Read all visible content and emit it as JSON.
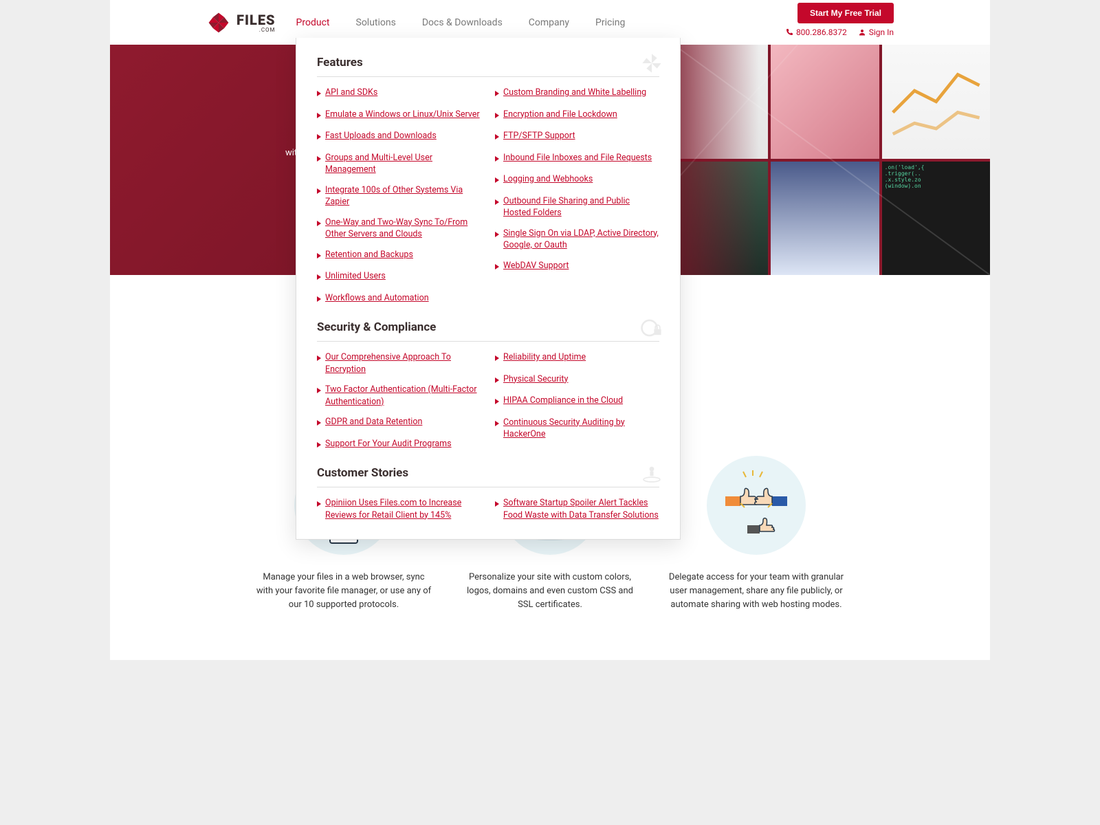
{
  "header": {
    "brand": {
      "word": "FILES",
      "tld": ".COM"
    },
    "nav": [
      {
        "label": "Product",
        "active": true
      },
      {
        "label": "Solutions",
        "active": false
      },
      {
        "label": "Docs & Downloads",
        "active": false
      },
      {
        "label": "Company",
        "active": false
      },
      {
        "label": "Pricing",
        "active": false
      }
    ],
    "trial": "Start My Free Trial",
    "phone": "800.286.8372",
    "signin": "Sign In"
  },
  "hero": {
    "sub_fragment": "with"
  },
  "mega": {
    "sections": [
      {
        "title": "Features",
        "left": [
          "API and SDKs",
          "Emulate a Windows or Linux/Unix Server",
          "Fast Uploads and Downloads",
          "Groups and Multi-Level User Management",
          "Integrate 100s of Other Systems Via Zapier",
          "One-Way and Two-Way Sync To/From Other Servers and Clouds",
          "Retention and Backups",
          "Unlimited Users",
          "Workflows and Automation"
        ],
        "right": [
          "Custom Branding and White Labelling",
          "Encryption and File Lockdown",
          "FTP/SFTP Support",
          "Inbound File Inboxes and File Requests",
          "Logging and Webhooks",
          "Outbound File Sharing and Public Hosted Folders",
          "Single Sign On via LDAP, Active Directory, Google, or Oauth",
          "WebDAV Support"
        ]
      },
      {
        "title": "Security & Compliance",
        "left": [
          "Our Comprehensive Approach To Encryption",
          "Two Factor Authentication (Multi-Factor Authentication)",
          "GDPR and Data Retention",
          "Support For Your Audit Programs"
        ],
        "right": [
          "Reliability and Uptime",
          "Physical Security",
          "HIPAA Compliance in the Cloud",
          "Continuous Security Auditing by HackerOne"
        ]
      },
      {
        "title": "Customer Stories",
        "left": [
          "Opiniion Uses Files.com to Increase Reviews for Retail Client by 145%"
        ],
        "right": [
          "Software Startup Spoiler Alert Tackles Food Waste with Data Transfer Solutions"
        ]
      }
    ]
  },
  "cards": [
    {
      "text": "Manage your files in a web browser, sync with your favorite file manager, or use any of our 10 supported protocols."
    },
    {
      "text": "Personalize your site with custom colors, logos, domains and even custom CSS and SSL certificates."
    },
    {
      "text": "Delegate access for your team with granular user management, share any file publicly, or automate sharing with web hosting modes."
    }
  ]
}
